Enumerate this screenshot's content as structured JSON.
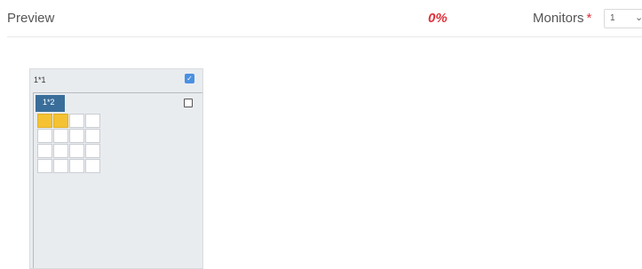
{
  "header": {
    "title": "Preview",
    "progress_percent": "0%",
    "monitors_label": "Monitors",
    "required_marker": "*",
    "monitors_select": {
      "value": "1",
      "chevron": "⌄"
    }
  },
  "layout_card": {
    "label": "1*1",
    "checked": true,
    "inner_frame": {
      "tag_label": "1*2",
      "checked": false,
      "grid": {
        "rows": 4,
        "cols": 4,
        "selected_cells": [
          [
            0,
            0
          ],
          [
            0,
            1
          ]
        ]
      }
    }
  },
  "colors": {
    "accent_red": "#e0313b",
    "checkbox_blue": "#4a90e2",
    "tag_blue": "#3a6e9a",
    "selected_cell": "#f5c233",
    "card_bg": "#e9ecef"
  }
}
